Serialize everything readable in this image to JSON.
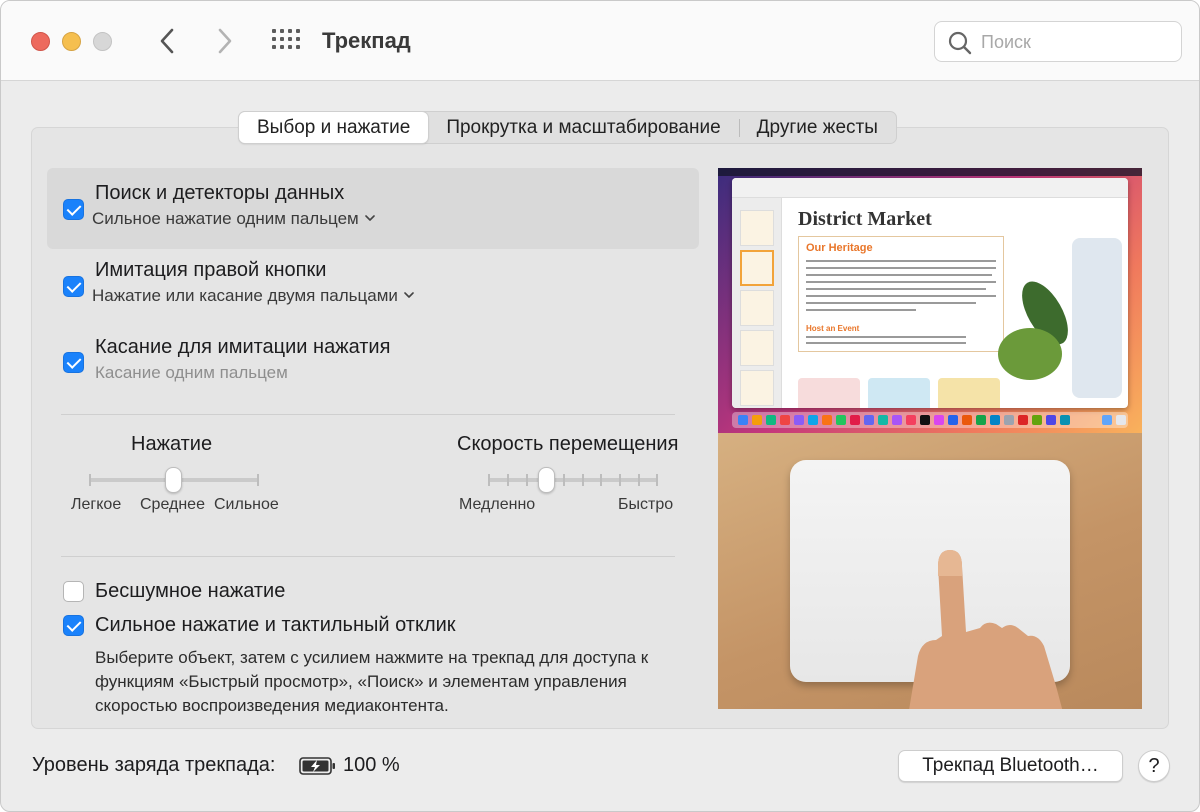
{
  "window": {
    "title": "Трекпад"
  },
  "search": {
    "placeholder": "Поиск"
  },
  "tabs": [
    {
      "label": "Выбор и нажатие",
      "active": true
    },
    {
      "label": "Прокрутка и масштабирование",
      "active": false
    },
    {
      "label": "Другие жесты",
      "active": false
    }
  ],
  "options": [
    {
      "title": "Поиск и детекторы данных",
      "subtitle": "Сильное нажатие одним пальцем",
      "checked": true,
      "has_dropdown": true
    },
    {
      "title": "Имитация правой кнопки",
      "subtitle": "Нажатие или касание двумя пальцами",
      "checked": true,
      "has_dropdown": true
    },
    {
      "title": "Касание для имитации нажатия",
      "subtitle": "Касание одним пальцем",
      "checked": true,
      "has_dropdown": false
    }
  ],
  "click_slider": {
    "title": "Нажатие",
    "labels": [
      "Легкое",
      "Среднее",
      "Сильное"
    ],
    "positions": 3,
    "value_index": 1
  },
  "speed_slider": {
    "title": "Скорость перемещения",
    "min_label": "Медленно",
    "max_label": "Быстро",
    "positions": 10,
    "value_index": 3
  },
  "silent_click": {
    "label": "Бесшумное нажатие",
    "checked": false
  },
  "force_click": {
    "label": "Сильное нажатие и тактильный отклик",
    "checked": true,
    "description": "Выберите объект, затем с усилием нажмите на трекпад для доступа к функциям «Быстрый просмотр», «Поиск» и элементам управления скоростью воспроизведения медиаконтента."
  },
  "preview": {
    "doc_title": "District Market",
    "doc_heading": "Our Heritage",
    "doc_subheading": "Host an Event"
  },
  "battery": {
    "label": "Уровень заряда трекпада:",
    "value": "100 %"
  },
  "buttons": {
    "bluetooth": "Трекпад Bluetooth…",
    "help": "?"
  },
  "colors": {
    "accent": "#1a82fb",
    "close": "#ed6a5e",
    "minimize": "#f5bf4f",
    "zoom": "#d7d7d7"
  }
}
